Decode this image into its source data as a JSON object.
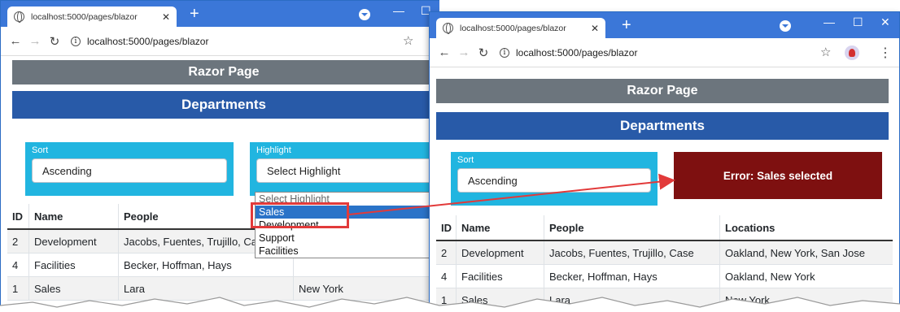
{
  "left": {
    "tab_title": "localhost:5000/pages/blazor",
    "url": "localhost:5000/pages/blazor",
    "razor_header": "Razor Page",
    "departments_header": "Departments",
    "sort": {
      "label": "Sort",
      "value": "Ascending"
    },
    "highlight": {
      "label": "Highlight",
      "value": "Select Highlight"
    },
    "dropdown_options": [
      "Select Highlight",
      "Sales",
      "Development",
      "Support",
      "Facilities"
    ],
    "dropdown_selected": "Sales",
    "columns": [
      "ID",
      "Name",
      "People"
    ],
    "rows": [
      {
        "id": "2",
        "name": "Development",
        "people": "Jacobs, Fuentes, Trujillo, Ca",
        "locations": ""
      },
      {
        "id": "4",
        "name": "Facilities",
        "people": "Becker, Hoffman, Hays",
        "locations": ""
      },
      {
        "id": "1",
        "name": "Sales",
        "people": "Lara",
        "locations": "New York"
      }
    ]
  },
  "right": {
    "tab_title": "localhost:5000/pages/blazor",
    "url": "localhost:5000/pages/blazor",
    "razor_header": "Razor Page",
    "departments_header": "Departments",
    "sort": {
      "label": "Sort",
      "value": "Ascending"
    },
    "error_text": "Error: Sales selected",
    "columns": [
      "ID",
      "Name",
      "People",
      "Locations"
    ],
    "rows": [
      {
        "id": "2",
        "name": "Development",
        "people": "Jacobs, Fuentes, Trujillo, Case",
        "locations": "Oakland, New York, San Jose"
      },
      {
        "id": "4",
        "name": "Facilities",
        "people": "Becker, Hoffman, Hays",
        "locations": "Oakland, New York"
      },
      {
        "id": "1",
        "name": "Sales",
        "people": "Lara",
        "locations": "New York"
      }
    ]
  },
  "icons": {
    "tab_favicon": "globe-icon",
    "back": "arrow-left-icon",
    "forward": "arrow-right-icon",
    "reload": "reload-icon",
    "site_info": "info-icon",
    "bookmark": "star-icon",
    "extension": "extension-icon",
    "menu": "kebab-menu-icon"
  },
  "colors": {
    "titlebar": "#3b77d8",
    "header_grey": "#6c757d",
    "header_blue": "#285aa8",
    "control_box": "#21b5e0",
    "error_box": "#7e1010",
    "dropdown_selected": "#2a73c8",
    "callout": "#e23a3a"
  }
}
